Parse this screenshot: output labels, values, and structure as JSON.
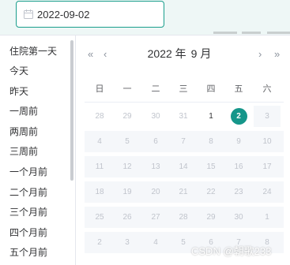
{
  "date_input": {
    "value": "2022-09-02",
    "icon": "calendar-icon"
  },
  "shortcuts": [
    "住院第一天",
    "今天",
    "昨天",
    "一周前",
    "两周前",
    "三周前",
    "一个月前",
    "二个月前",
    "三个月前",
    "四个月前",
    "五个月前"
  ],
  "calendar": {
    "year_label": "2022 年",
    "month_label": "9 月",
    "nav": {
      "prev_year": "«",
      "prev_month": "‹",
      "next_month": "›",
      "next_year": "»"
    },
    "weekdays": [
      "日",
      "一",
      "二",
      "三",
      "四",
      "五",
      "六"
    ],
    "weeks": [
      [
        "28",
        "29",
        "30",
        "31",
        "1",
        "2",
        "3"
      ],
      [
        "4",
        "5",
        "6",
        "7",
        "8",
        "9",
        "10"
      ],
      [
        "11",
        "12",
        "13",
        "14",
        "15",
        "16",
        "17"
      ],
      [
        "18",
        "19",
        "20",
        "21",
        "22",
        "23",
        "24"
      ],
      [
        "25",
        "26",
        "27",
        "28",
        "29",
        "30",
        "1"
      ],
      [
        "2",
        "3",
        "4",
        "5",
        "6",
        "7",
        "8"
      ]
    ],
    "selected_day": "2",
    "accent_color": "#15968a"
  },
  "watermark": "CSDN @朝歌233"
}
